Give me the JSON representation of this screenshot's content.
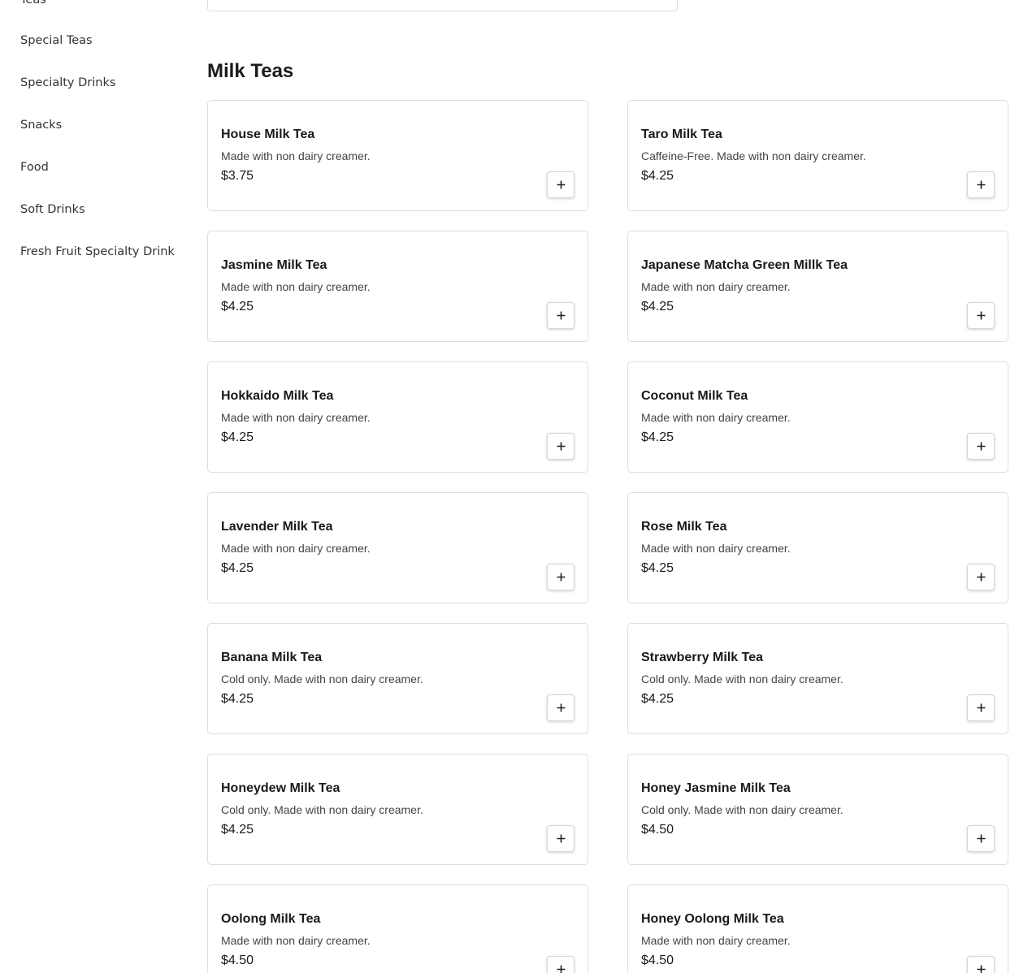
{
  "sidebar": {
    "items": [
      {
        "label": "Teas"
      },
      {
        "label": "Special Teas"
      },
      {
        "label": "Specialty Drinks"
      },
      {
        "label": "Snacks"
      },
      {
        "label": "Food"
      },
      {
        "label": "Soft Drinks"
      },
      {
        "label": "Fresh Fruit Specialty Drink"
      }
    ]
  },
  "section": {
    "title": "Milk Teas",
    "items": [
      {
        "name": "House Milk Tea",
        "desc": "Made with non dairy creamer.",
        "price": "$3.75"
      },
      {
        "name": "Taro Milk Tea",
        "desc": "Caffeine-Free. Made with non dairy creamer.",
        "price": "$4.25"
      },
      {
        "name": "Jasmine Milk Tea",
        "desc": "Made with non dairy creamer.",
        "price": "$4.25"
      },
      {
        "name": "Japanese Matcha Green Millk Tea",
        "desc": "Made with non dairy creamer.",
        "price": "$4.25"
      },
      {
        "name": "Hokkaido Milk Tea",
        "desc": "Made with non dairy creamer.",
        "price": "$4.25"
      },
      {
        "name": "Coconut Milk Tea",
        "desc": "Made with non dairy creamer.",
        "price": "$4.25"
      },
      {
        "name": "Lavender Milk Tea",
        "desc": "Made with non dairy creamer.",
        "price": "$4.25"
      },
      {
        "name": "Rose Milk Tea",
        "desc": "Made with non dairy creamer.",
        "price": "$4.25"
      },
      {
        "name": "Banana Milk Tea",
        "desc": "Cold only. Made with non dairy creamer.",
        "price": "$4.25"
      },
      {
        "name": "Strawberry Milk Tea",
        "desc": "Cold only. Made with non dairy creamer.",
        "price": "$4.25"
      },
      {
        "name": "Honeydew Milk Tea",
        "desc": "Cold only. Made with non dairy creamer.",
        "price": "$4.25"
      },
      {
        "name": "Honey Jasmine Milk Tea",
        "desc": "Cold only. Made with non dairy creamer.",
        "price": "$4.50"
      },
      {
        "name": "Oolong Milk Tea",
        "desc": "Made with non dairy creamer.",
        "price": "$4.50"
      },
      {
        "name": "Honey Oolong Milk Tea",
        "desc": "Made with non dairy creamer.",
        "price": "$4.50"
      }
    ]
  },
  "icons": {
    "add": "plus-icon"
  }
}
